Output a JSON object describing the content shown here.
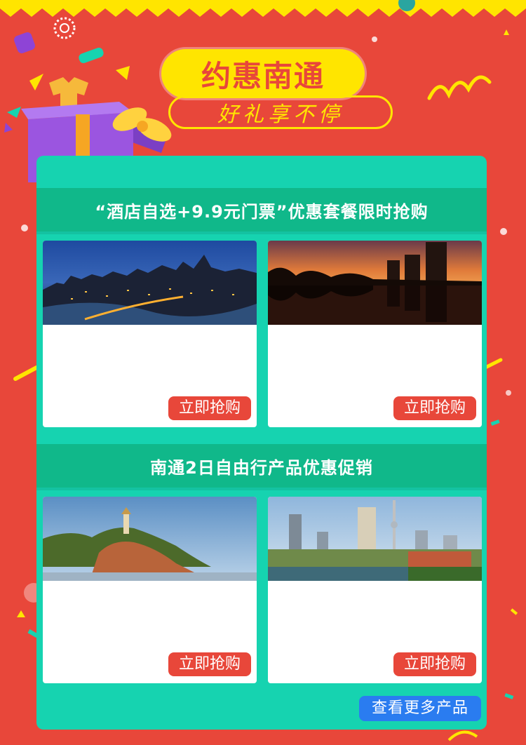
{
  "header": {
    "title": "约惠南通",
    "subtitle": "好礼享不停"
  },
  "colors": {
    "background": "#e8473a",
    "accent_yellow": "#ffe500",
    "panel_teal": "#16d3b0",
    "section_green": "#10b88a",
    "button_red": "#e8473a",
    "button_blue": "#2a7cf0"
  },
  "sections": [
    {
      "heading": "“酒店自选+9.9元门票”优惠套餐限时抢购",
      "cards": [
        {
          "image": "city-night-skyline",
          "button": "立即抢购"
        },
        {
          "image": "sunset-lake-reflection",
          "button": "立即抢购"
        }
      ]
    },
    {
      "heading": "南通2日自由行产品优惠促销",
      "cards": [
        {
          "image": "hill-pagoda",
          "button": "立即抢购"
        },
        {
          "image": "city-tower-river",
          "button": "立即抢购"
        }
      ]
    }
  ],
  "more_button": "查看更多产品"
}
